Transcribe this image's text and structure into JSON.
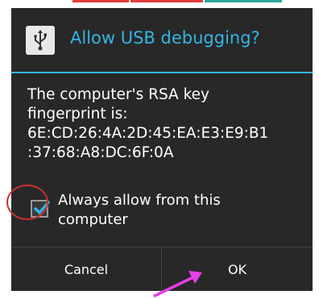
{
  "dialog": {
    "title": "Allow USB debugging?",
    "icon": "usb-icon",
    "message_lines": [
      "The computer's RSA key",
      "fingerprint is:",
      "6E:CD:26:4A:2D:45:EA:E3:E9:B1",
      ":37:68:A8:DC:6F:0A"
    ],
    "checkbox": {
      "label": "Always allow from this computer",
      "checked": true
    },
    "buttons": {
      "cancel": "Cancel",
      "ok": "OK"
    }
  },
  "colors": {
    "accent": "#33b5e5",
    "dialog_background": "#282828",
    "annotation_circle": "#c8322e",
    "annotation_arrow": "#e83ee8",
    "top_strip": [
      "#e23b3b",
      "#e23b3b",
      "#2aa59b"
    ]
  }
}
